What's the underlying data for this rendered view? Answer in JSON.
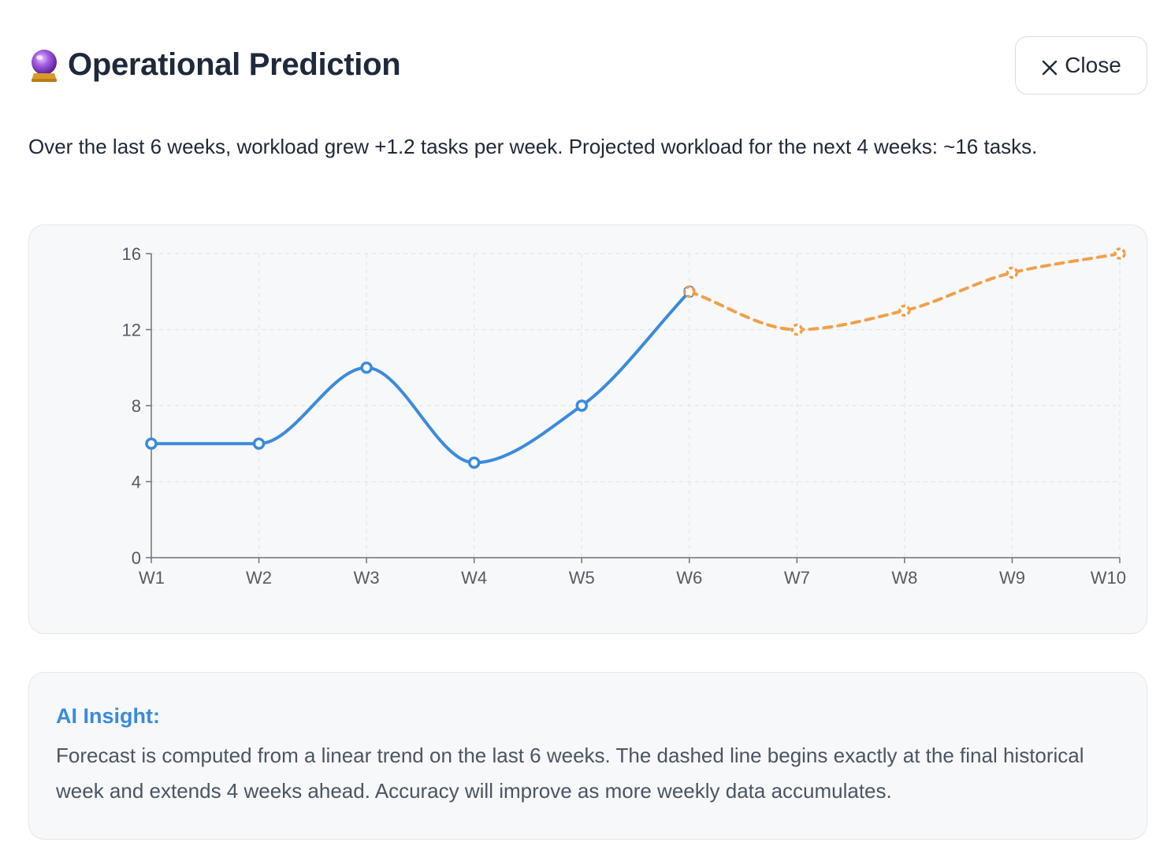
{
  "header": {
    "title": "Operational Prediction",
    "title_icon": "crystal-ball-icon",
    "close_label": "Close",
    "close_icon": "close-icon"
  },
  "summary": "Over the last 6 weeks, workload grew +1.2 tasks per week. Projected workload for the next 4 weeks: ~16 tasks.",
  "chart_data": {
    "type": "line",
    "categories": [
      "W1",
      "W2",
      "W3",
      "W4",
      "W5",
      "W6",
      "W7",
      "W8",
      "W9",
      "W10"
    ],
    "series": [
      {
        "values": [
          6,
          6,
          10,
          5,
          8,
          14,
          null,
          null,
          null,
          null
        ],
        "color": "#3b8bdb",
        "style": "solid"
      },
      {
        "values": [
          null,
          null,
          null,
          null,
          null,
          14,
          12,
          13,
          15,
          16
        ],
        "color": "#f0a04b",
        "style": "dashed"
      }
    ],
    "ylim": [
      0,
      16
    ],
    "yticks": [
      "0",
      "4",
      "8",
      "12",
      "16"
    ],
    "grid": true
  },
  "insight": {
    "title": "AI Insight:",
    "text": "Forecast is computed from a linear trend on the last 6 weeks. The dashed line begins exactly at the final historical week and extends 4 weeks ahead. Accuracy will improve as more weekly data accumulates."
  },
  "colors": {
    "history": "#3b8bdb",
    "forecast": "#f0a04b",
    "accent": "#3b8bdb"
  }
}
